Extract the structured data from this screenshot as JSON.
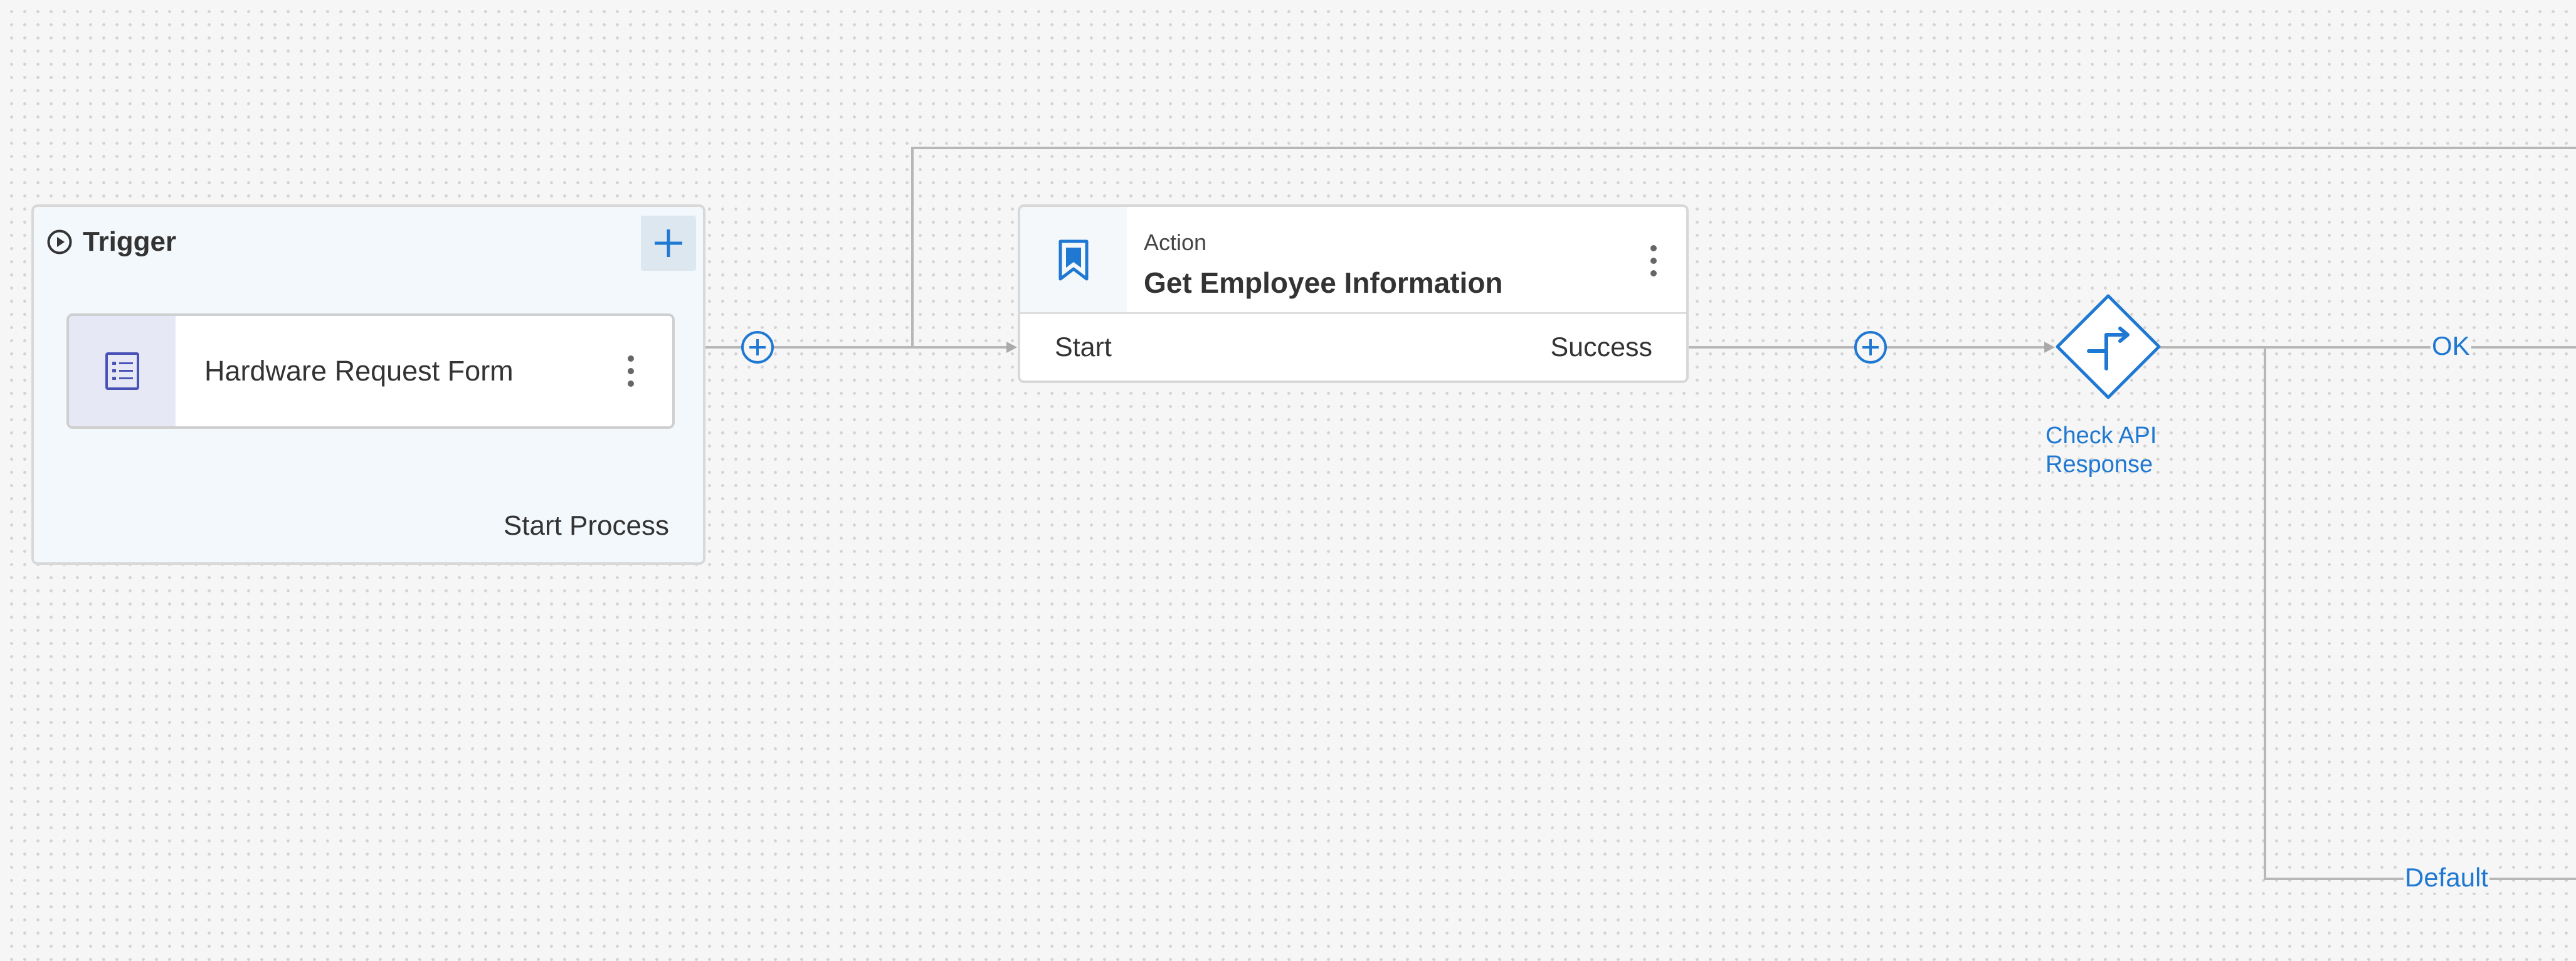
{
  "trigger": {
    "title": "Trigger",
    "add_button": "+",
    "form_name": "Hardware Request Form",
    "footer": "Start Process"
  },
  "action": {
    "type": "Action",
    "title": "Get Employee Information",
    "start_label": "Start",
    "success_label": "Success"
  },
  "decision": {
    "label_line1": "Check API",
    "label_line2": "Response",
    "branches": {
      "ok": "OK",
      "default": "Default"
    }
  },
  "icons": {
    "trigger": "play-circle-icon",
    "form": "form-list-icon",
    "action": "bookmark-icon",
    "decision": "split-arrow-icon",
    "add_step": "plus-circle-icon",
    "menu": "kebab-menu-icon"
  },
  "colors": {
    "accent": "#1f78d1",
    "connector": "#b7b7b7",
    "trigger_bg": "#f3f8fc",
    "form_icon_bg": "#e7e8f5",
    "canvas_bg": "#f6f6f6"
  }
}
